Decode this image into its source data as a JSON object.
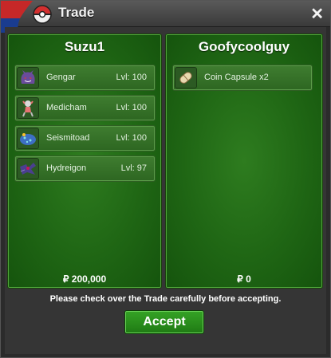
{
  "window": {
    "title": "Trade",
    "close_symbol": "✕"
  },
  "left": {
    "player": "Suzu1",
    "items": [
      {
        "name": "Gengar",
        "level": "Lvl: 100",
        "icon": "gengar-icon"
      },
      {
        "name": "Medicham",
        "level": "Lvl: 100",
        "icon": "medicham-icon"
      },
      {
        "name": "Seismitoad",
        "level": "Lvl: 100",
        "icon": "seismitoad-icon"
      },
      {
        "name": "Hydreigon",
        "level": "Lvl: 97",
        "icon": "hydreigon-icon"
      }
    ],
    "money": "₽ 200,000"
  },
  "right": {
    "player": "Goofycoolguy",
    "items": [
      {
        "name": "Coin Capsule  x2",
        "level": "",
        "icon": "coin-capsule-icon"
      }
    ],
    "money": "₽ 0"
  },
  "notice": "Please check over the Trade carefully before accepting.",
  "accept_label": "Accept",
  "colors": {
    "panel_green": "#1f6614",
    "button_green": "#2a8f1c",
    "titlebar": "#4a4a4a"
  }
}
